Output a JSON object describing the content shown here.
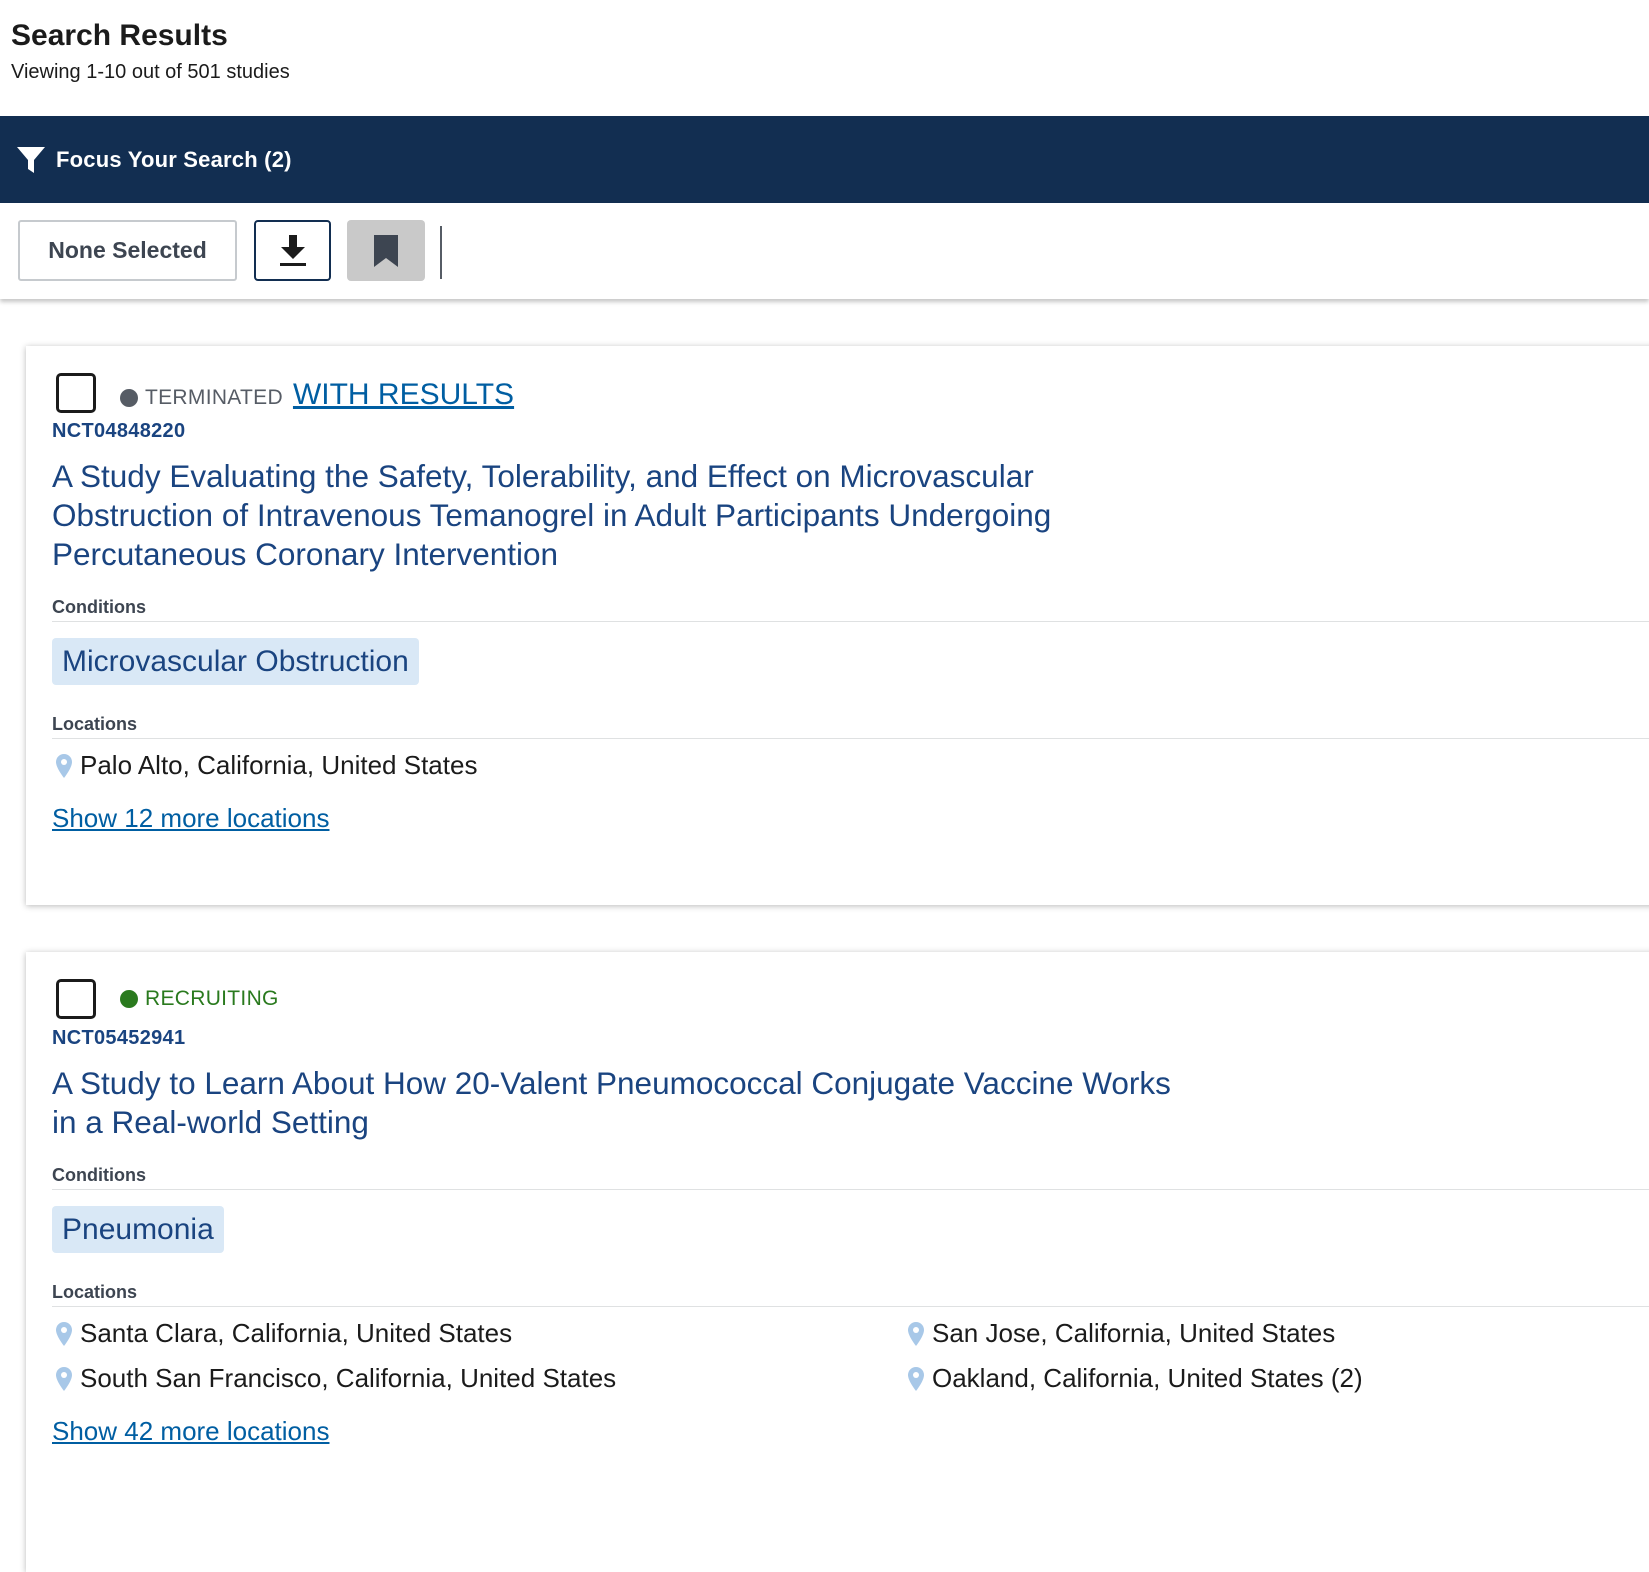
{
  "header": {
    "title": "Search Results",
    "subtitle": "Viewing 1-10 out of 501 studies"
  },
  "focus_bar": {
    "label": "Focus Your Search (2)",
    "icon": "filter-icon"
  },
  "toolbar": {
    "select_label": "None Selected",
    "download_icon": "download-icon",
    "bookmark_icon": "bookmark-icon"
  },
  "colors": {
    "navy": "#122e51",
    "link": "#005ea2",
    "title_blue": "#1a4480",
    "chip_bg": "#d9e8f6",
    "terminated_gray": "#565c65",
    "recruiting_green": "#2a7a1e"
  },
  "studies": [
    {
      "status": "TERMINATED",
      "results_link": "WITH RESULTS",
      "nct_id": "NCT04848220",
      "title": "A Study Evaluating the Safety, Tolerability, and Effect on Microvascular Obstruction of Intravenous Temanogrel in Adult Participants Undergoing Percutaneous Coronary Intervention",
      "conditions_label": "Conditions",
      "conditions": [
        "Microvascular Obstruction"
      ],
      "locations_label": "Locations",
      "locations": [
        "Palo Alto, California, United States"
      ],
      "more_locations": "Show 12 more locations"
    },
    {
      "status": "RECRUITING",
      "nct_id": "NCT05452941",
      "title": "A Study to Learn About How 20-Valent Pneumococcal Conjugate Vaccine Works in a Real-world Setting",
      "conditions_label": "Conditions",
      "conditions": [
        "Pneumonia"
      ],
      "locations_label": "Locations",
      "locations": [
        "Santa Clara, California, United States",
        "San Jose, California, United States",
        "South San Francisco, California, United States",
        "Oakland, California, United States (2)"
      ],
      "more_locations": "Show 42 more locations"
    }
  ]
}
